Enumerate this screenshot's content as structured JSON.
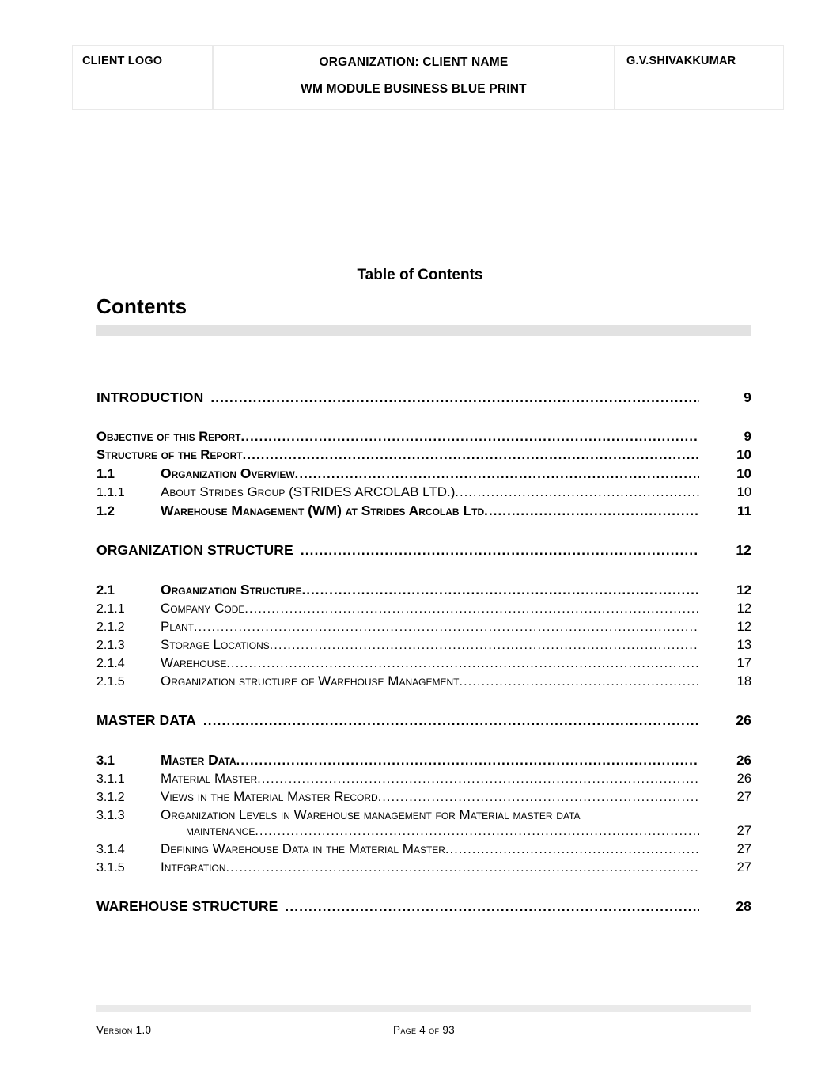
{
  "header": {
    "left_label": "CLIENT LOGO",
    "center_line1": "ORGANIZATION: CLIENT NAME",
    "center_line2": "WM MODULE BUSINESS BLUE PRINT",
    "right_label": "G.V.SHIVAKKUMAR"
  },
  "titles": {
    "toc_title": "Table of Contents",
    "contents_heading": "Contents"
  },
  "leader_dots": "..............................................................................................................................................................................................................",
  "toc": {
    "entries": [
      {
        "level": 1,
        "num": "",
        "label": "INTRODUCTION",
        "page": "9"
      },
      {
        "level": "1b",
        "num": "",
        "label": "Objective of this  Report",
        "page": "9"
      },
      {
        "level": "1b",
        "num": "",
        "label": "Structure of the Report",
        "page": "10"
      },
      {
        "level": 2,
        "num": "1.1",
        "label": "Organization  Overview",
        "page": "10"
      },
      {
        "level": 3,
        "num": "1.1.1",
        "label": "About Strides Group (STRIDES ARCOLAB LTD.)",
        "page": "10"
      },
      {
        "level": 2,
        "num": "1.2",
        "label": "Warehouse Management (WM)  at Strides Arcolab Ltd",
        "page": "11"
      },
      {
        "level": 1,
        "num": "",
        "label": "ORGANIZATION STRUCTURE",
        "page": "12"
      },
      {
        "level": 2,
        "num": "2.1",
        "label": "Organization  Structure",
        "page": "12"
      },
      {
        "level": 3,
        "num": "2.1.1",
        "label": "Company Code",
        "page": "12"
      },
      {
        "level": 3,
        "num": "2.1.2",
        "label": "Plant",
        "page": "12"
      },
      {
        "level": 3,
        "num": "2.1.3",
        "label": "Storage Locations",
        "page": "13"
      },
      {
        "level": 3,
        "num": "2.1.4",
        "label": "Warehouse",
        "page": "17"
      },
      {
        "level": 3,
        "num": "2.1.5",
        "label": "Organization structure of Warehouse Management",
        "page": "18"
      },
      {
        "level": 1,
        "num": "",
        "label": "MASTER DATA",
        "page": "26"
      },
      {
        "level": 2,
        "num": "3.1",
        "label": "Master Data",
        "page": "26"
      },
      {
        "level": 3,
        "num": "3.1.1",
        "label": "Material Master",
        "page": "26"
      },
      {
        "level": 3,
        "num": "3.1.2",
        "label": "Views in the Material Master Record",
        "page": "27"
      },
      {
        "level": 3,
        "num": "3.1.3",
        "label": "Organization Levels in Warehouse management for Material master data",
        "label_line2": "maintenance",
        "page": "27"
      },
      {
        "level": 3,
        "num": "3.1.4",
        "label": "Defining Warehouse Data in the Material Master",
        "page": "27"
      },
      {
        "level": 3,
        "num": "3.1.5",
        "label": "Integration",
        "page": "27"
      },
      {
        "level": 1,
        "num": "",
        "label": "WAREHOUSE STRUCTURE",
        "page": "28"
      }
    ]
  },
  "footer": {
    "version": "Version 1.0",
    "page_info": "Page 4 of 93"
  },
  "colors": {
    "text": "#000000",
    "rule_bar": "#e2e2e2",
    "footer_bar": "#eaeaea",
    "header_border": "#e9e9e9"
  }
}
